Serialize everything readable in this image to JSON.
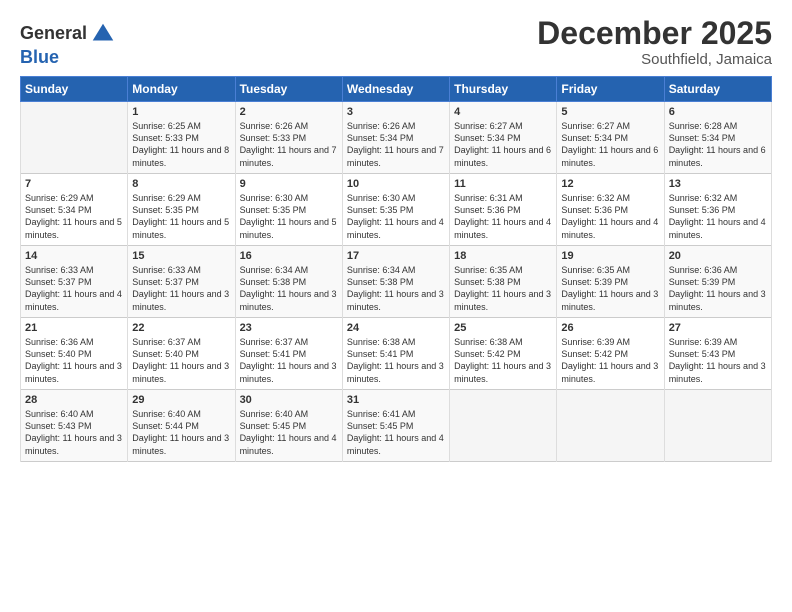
{
  "header": {
    "logo_line1": "General",
    "logo_line2": "Blue",
    "month_year": "December 2025",
    "location": "Southfield, Jamaica"
  },
  "columns": [
    "Sunday",
    "Monday",
    "Tuesday",
    "Wednesday",
    "Thursday",
    "Friday",
    "Saturday"
  ],
  "weeks": [
    [
      {
        "day": "",
        "sunrise": "",
        "sunset": "",
        "daylight": ""
      },
      {
        "day": "1",
        "sunrise": "Sunrise: 6:25 AM",
        "sunset": "Sunset: 5:33 PM",
        "daylight": "Daylight: 11 hours and 8 minutes."
      },
      {
        "day": "2",
        "sunrise": "Sunrise: 6:26 AM",
        "sunset": "Sunset: 5:33 PM",
        "daylight": "Daylight: 11 hours and 7 minutes."
      },
      {
        "day": "3",
        "sunrise": "Sunrise: 6:26 AM",
        "sunset": "Sunset: 5:34 PM",
        "daylight": "Daylight: 11 hours and 7 minutes."
      },
      {
        "day": "4",
        "sunrise": "Sunrise: 6:27 AM",
        "sunset": "Sunset: 5:34 PM",
        "daylight": "Daylight: 11 hours and 6 minutes."
      },
      {
        "day": "5",
        "sunrise": "Sunrise: 6:27 AM",
        "sunset": "Sunset: 5:34 PM",
        "daylight": "Daylight: 11 hours and 6 minutes."
      },
      {
        "day": "6",
        "sunrise": "Sunrise: 6:28 AM",
        "sunset": "Sunset: 5:34 PM",
        "daylight": "Daylight: 11 hours and 6 minutes."
      }
    ],
    [
      {
        "day": "7",
        "sunrise": "Sunrise: 6:29 AM",
        "sunset": "Sunset: 5:34 PM",
        "daylight": "Daylight: 11 hours and 5 minutes."
      },
      {
        "day": "8",
        "sunrise": "Sunrise: 6:29 AM",
        "sunset": "Sunset: 5:35 PM",
        "daylight": "Daylight: 11 hours and 5 minutes."
      },
      {
        "day": "9",
        "sunrise": "Sunrise: 6:30 AM",
        "sunset": "Sunset: 5:35 PM",
        "daylight": "Daylight: 11 hours and 5 minutes."
      },
      {
        "day": "10",
        "sunrise": "Sunrise: 6:30 AM",
        "sunset": "Sunset: 5:35 PM",
        "daylight": "Daylight: 11 hours and 4 minutes."
      },
      {
        "day": "11",
        "sunrise": "Sunrise: 6:31 AM",
        "sunset": "Sunset: 5:36 PM",
        "daylight": "Daylight: 11 hours and 4 minutes."
      },
      {
        "day": "12",
        "sunrise": "Sunrise: 6:32 AM",
        "sunset": "Sunset: 5:36 PM",
        "daylight": "Daylight: 11 hours and 4 minutes."
      },
      {
        "day": "13",
        "sunrise": "Sunrise: 6:32 AM",
        "sunset": "Sunset: 5:36 PM",
        "daylight": "Daylight: 11 hours and 4 minutes."
      }
    ],
    [
      {
        "day": "14",
        "sunrise": "Sunrise: 6:33 AM",
        "sunset": "Sunset: 5:37 PM",
        "daylight": "Daylight: 11 hours and 4 minutes."
      },
      {
        "day": "15",
        "sunrise": "Sunrise: 6:33 AM",
        "sunset": "Sunset: 5:37 PM",
        "daylight": "Daylight: 11 hours and 3 minutes."
      },
      {
        "day": "16",
        "sunrise": "Sunrise: 6:34 AM",
        "sunset": "Sunset: 5:38 PM",
        "daylight": "Daylight: 11 hours and 3 minutes."
      },
      {
        "day": "17",
        "sunrise": "Sunrise: 6:34 AM",
        "sunset": "Sunset: 5:38 PM",
        "daylight": "Daylight: 11 hours and 3 minutes."
      },
      {
        "day": "18",
        "sunrise": "Sunrise: 6:35 AM",
        "sunset": "Sunset: 5:38 PM",
        "daylight": "Daylight: 11 hours and 3 minutes."
      },
      {
        "day": "19",
        "sunrise": "Sunrise: 6:35 AM",
        "sunset": "Sunset: 5:39 PM",
        "daylight": "Daylight: 11 hours and 3 minutes."
      },
      {
        "day": "20",
        "sunrise": "Sunrise: 6:36 AM",
        "sunset": "Sunset: 5:39 PM",
        "daylight": "Daylight: 11 hours and 3 minutes."
      }
    ],
    [
      {
        "day": "21",
        "sunrise": "Sunrise: 6:36 AM",
        "sunset": "Sunset: 5:40 PM",
        "daylight": "Daylight: 11 hours and 3 minutes."
      },
      {
        "day": "22",
        "sunrise": "Sunrise: 6:37 AM",
        "sunset": "Sunset: 5:40 PM",
        "daylight": "Daylight: 11 hours and 3 minutes."
      },
      {
        "day": "23",
        "sunrise": "Sunrise: 6:37 AM",
        "sunset": "Sunset: 5:41 PM",
        "daylight": "Daylight: 11 hours and 3 minutes."
      },
      {
        "day": "24",
        "sunrise": "Sunrise: 6:38 AM",
        "sunset": "Sunset: 5:41 PM",
        "daylight": "Daylight: 11 hours and 3 minutes."
      },
      {
        "day": "25",
        "sunrise": "Sunrise: 6:38 AM",
        "sunset": "Sunset: 5:42 PM",
        "daylight": "Daylight: 11 hours and 3 minutes."
      },
      {
        "day": "26",
        "sunrise": "Sunrise: 6:39 AM",
        "sunset": "Sunset: 5:42 PM",
        "daylight": "Daylight: 11 hours and 3 minutes."
      },
      {
        "day": "27",
        "sunrise": "Sunrise: 6:39 AM",
        "sunset": "Sunset: 5:43 PM",
        "daylight": "Daylight: 11 hours and 3 minutes."
      }
    ],
    [
      {
        "day": "28",
        "sunrise": "Sunrise: 6:40 AM",
        "sunset": "Sunset: 5:43 PM",
        "daylight": "Daylight: 11 hours and 3 minutes."
      },
      {
        "day": "29",
        "sunrise": "Sunrise: 6:40 AM",
        "sunset": "Sunset: 5:44 PM",
        "daylight": "Daylight: 11 hours and 3 minutes."
      },
      {
        "day": "30",
        "sunrise": "Sunrise: 6:40 AM",
        "sunset": "Sunset: 5:45 PM",
        "daylight": "Daylight: 11 hours and 4 minutes."
      },
      {
        "day": "31",
        "sunrise": "Sunrise: 6:41 AM",
        "sunset": "Sunset: 5:45 PM",
        "daylight": "Daylight: 11 hours and 4 minutes."
      },
      {
        "day": "",
        "sunrise": "",
        "sunset": "",
        "daylight": ""
      },
      {
        "day": "",
        "sunrise": "",
        "sunset": "",
        "daylight": ""
      },
      {
        "day": "",
        "sunrise": "",
        "sunset": "",
        "daylight": ""
      }
    ]
  ]
}
